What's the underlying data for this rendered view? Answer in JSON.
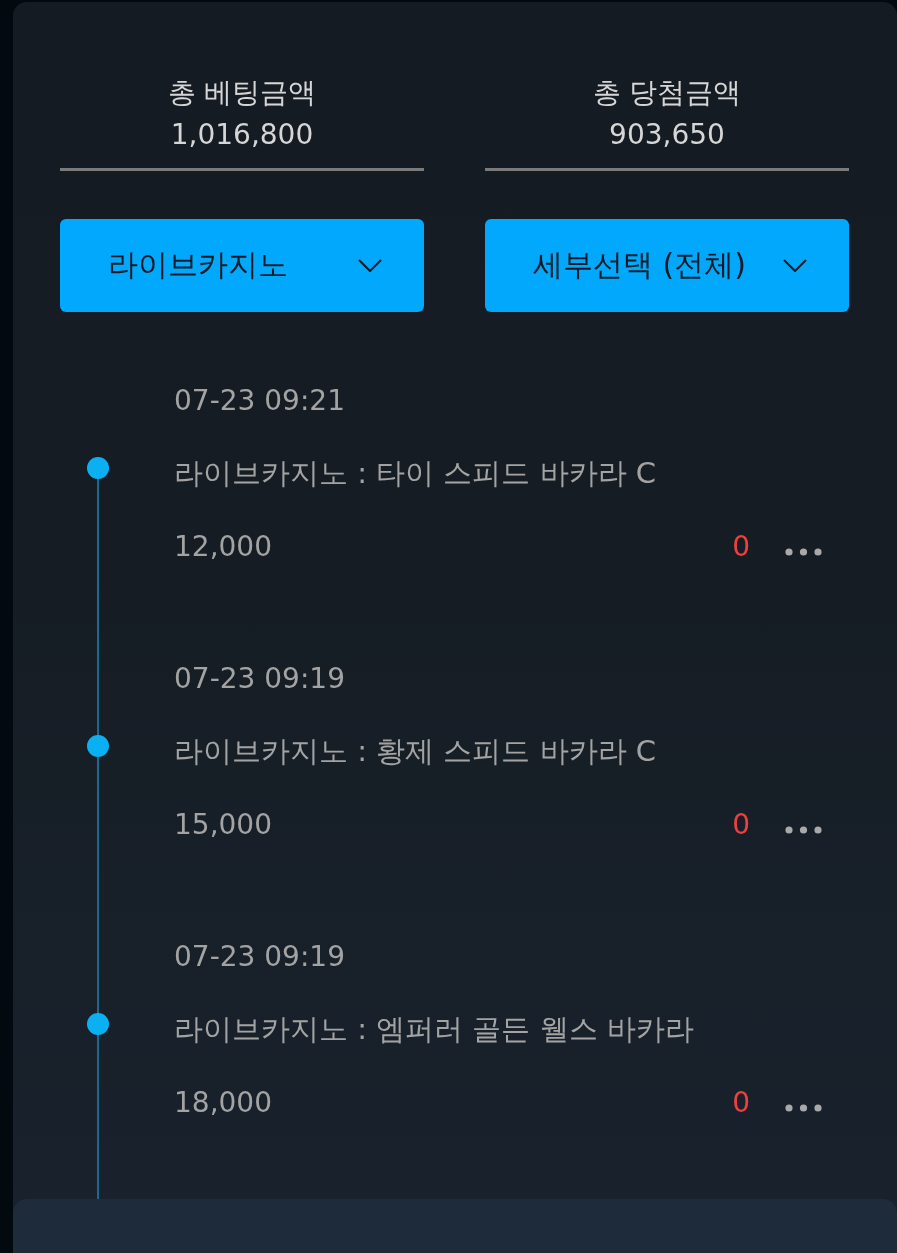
{
  "summary": [
    {
      "label": "총 베팅금액",
      "value": "1,016,800"
    },
    {
      "label": "총 당첨금액",
      "value": "903,650"
    }
  ],
  "filters": [
    {
      "label": "라이브카지노"
    },
    {
      "label": "세부선택 (전체)"
    }
  ],
  "entries": [
    {
      "time": "07-23 09:21",
      "title": "라이브카지노 : 타이 스피드 바카라 C",
      "amount": "12,000",
      "result": "0"
    },
    {
      "time": "07-23 09:19",
      "title": "라이브카지노 : 황제 스피드 바카라 C",
      "amount": "15,000",
      "result": "0"
    },
    {
      "time": "07-23 09:19",
      "title": "라이브카지노 : 엠퍼러 골든 웰스 바카라",
      "amount": "18,000",
      "result": "0"
    }
  ]
}
